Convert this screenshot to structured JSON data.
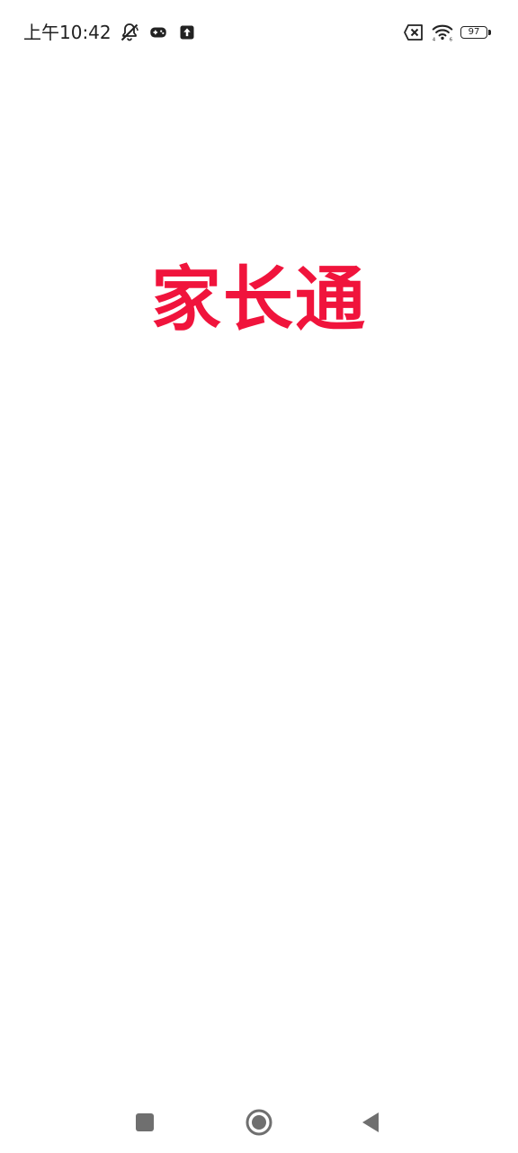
{
  "status_bar": {
    "time": "上午10:42",
    "icons_left": [
      "bell-muted-icon",
      "gamepad-icon",
      "upload-icon"
    ],
    "icons_right": [
      "sim-no-service-icon",
      "wifi-icon",
      "battery-icon"
    ],
    "battery_level": "97"
  },
  "splash": {
    "logo_text": "家长通",
    "brand_color": "#f0143c"
  },
  "nav_bar": {
    "buttons": [
      "recents-button",
      "home-button",
      "back-button"
    ]
  }
}
